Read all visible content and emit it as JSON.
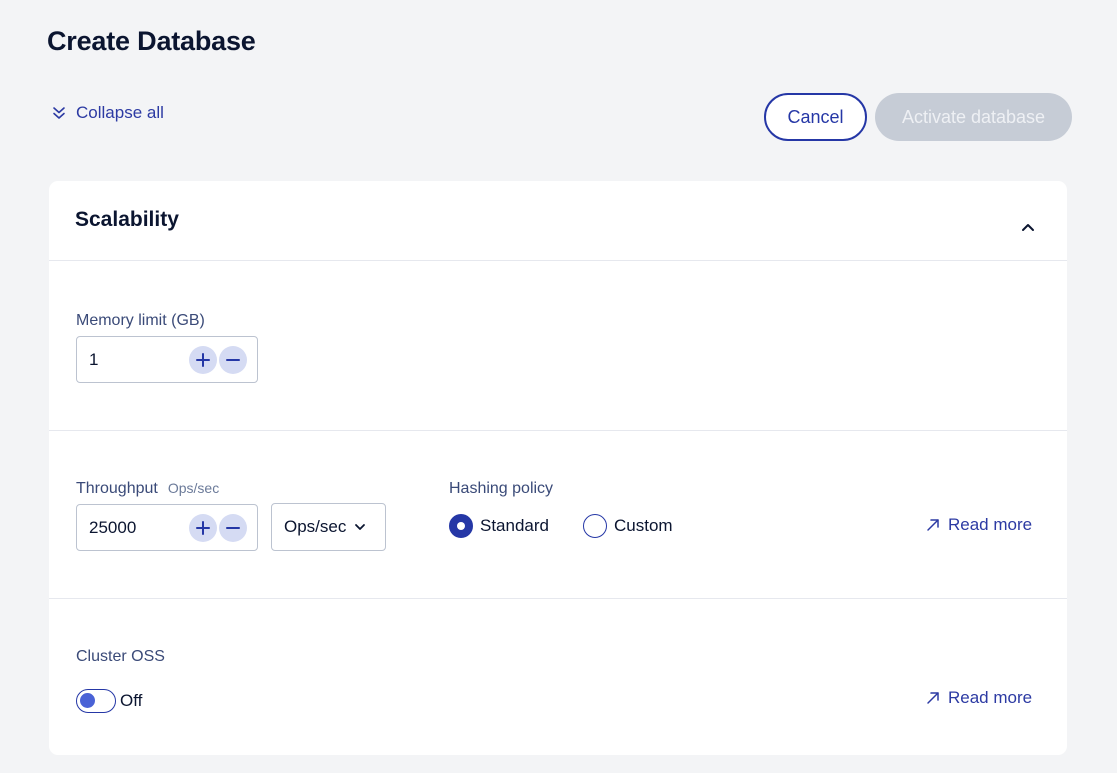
{
  "page": {
    "title": "Create Database",
    "collapse_all_label": "Collapse all"
  },
  "actions": {
    "cancel_label": "Cancel",
    "activate_label": "Activate database"
  },
  "scalability": {
    "title": "Scalability",
    "memory": {
      "label": "Memory limit (GB)",
      "value": "1"
    },
    "throughput": {
      "label": "Throughput",
      "sublabel": "Ops/sec",
      "value": "25000",
      "unit_selected": "Ops/sec"
    },
    "hashing": {
      "label": "Hashing policy",
      "options": [
        "Standard",
        "Custom"
      ],
      "selected": "Standard",
      "read_more": "Read more"
    },
    "cluster_oss": {
      "label": "Cluster OSS",
      "state_label": "Off",
      "read_more": "Read more"
    }
  },
  "colors": {
    "primary": "#2537a6",
    "disabled_button": "#c6ccd6",
    "background": "#f3f4f6",
    "stepper_bg": "#d5dbf3"
  },
  "icons": [
    "double-chevron-down-icon",
    "chevron-up-icon",
    "plus-icon",
    "minus-icon",
    "chevron-down-icon",
    "external-arrow-icon"
  ]
}
